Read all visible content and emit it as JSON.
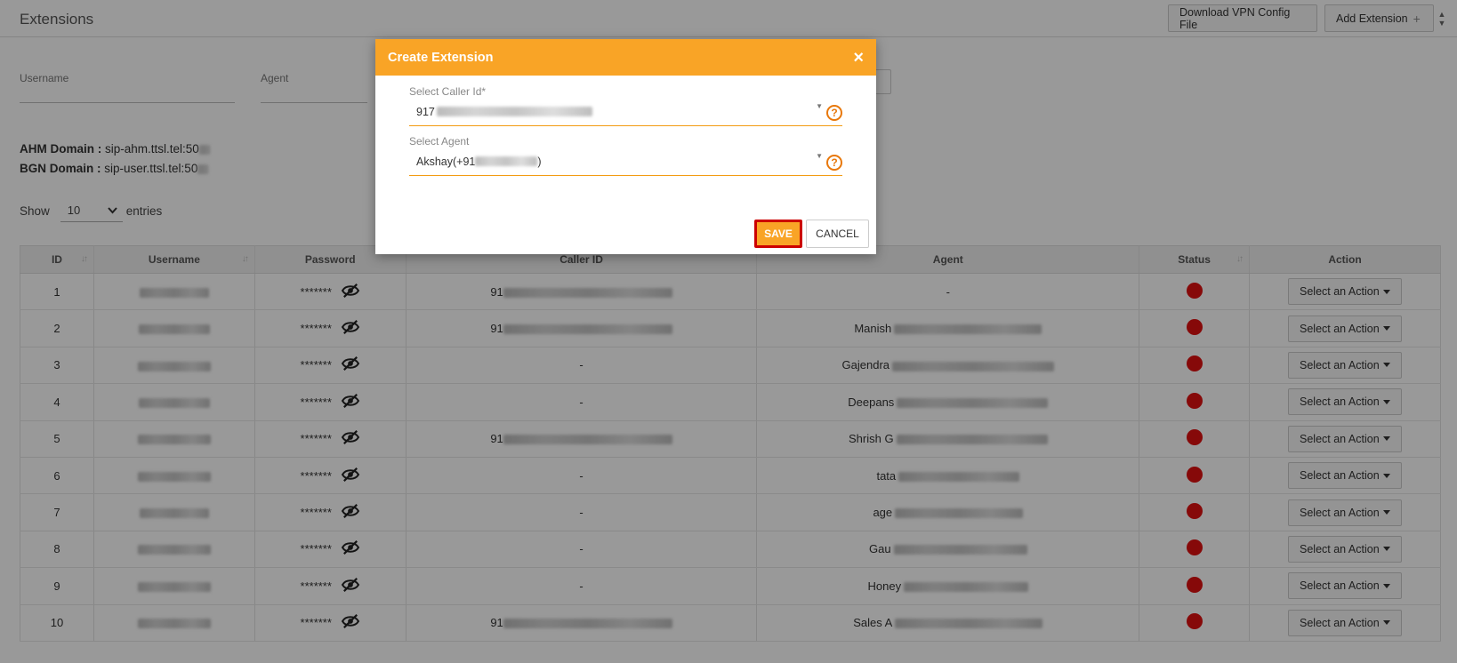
{
  "page": {
    "title": "Extensions",
    "download_vpn_label": "Download VPN Config File",
    "add_extension_label": "Add Extension",
    "add_extension_icon": "plus-icon"
  },
  "filters": {
    "username_label": "Username",
    "agent_label": "Agent"
  },
  "domains": {
    "ahm_label": "AHM Domain :",
    "ahm_value": "sip-ahm.ttsl.tel:50",
    "bgn_label": "BGN Domain :",
    "bgn_value": "sip-user.ttsl.tel:50"
  },
  "entries": {
    "show_label": "Show",
    "value": "10",
    "suffix": "entries"
  },
  "table": {
    "headers": [
      "ID",
      "Username",
      "Password",
      "Caller ID",
      "Agent",
      "Status",
      "Action"
    ],
    "rows": [
      {
        "id": "1",
        "password": "*******",
        "caller": "91",
        "agent": "-",
        "action": "Select an Action"
      },
      {
        "id": "2",
        "password": "*******",
        "caller": "91",
        "agent": "Manish",
        "action": "Select an Action"
      },
      {
        "id": "3",
        "password": "*******",
        "caller": "-",
        "agent": "Gajendra",
        "action": "Select an Action"
      },
      {
        "id": "4",
        "password": "*******",
        "caller": "-",
        "agent": "Deepans",
        "action": "Select an Action"
      },
      {
        "id": "5",
        "password": "*******",
        "caller": "91",
        "agent": "Shrish G",
        "action": "Select an Action"
      },
      {
        "id": "6",
        "password": "*******",
        "caller": "-",
        "agent": "tata",
        "action": "Select an Action"
      },
      {
        "id": "7",
        "password": "*******",
        "caller": "-",
        "agent": "age",
        "action": "Select an Action"
      },
      {
        "id": "8",
        "password": "*******",
        "caller": "-",
        "agent": "Gau",
        "action": "Select an Action"
      },
      {
        "id": "9",
        "password": "*******",
        "caller": "-",
        "agent": "Honey",
        "action": "Select an Action"
      },
      {
        "id": "10",
        "password": "*******",
        "caller": "91",
        "agent": "Sales A",
        "action": "Select an Action"
      }
    ],
    "status_color": "#e01010"
  },
  "modal": {
    "title": "Create Extension",
    "close": "×",
    "caller_label": "Select Caller Id*",
    "caller_value": "917",
    "agent_label": "Select Agent",
    "agent_value_prefix": "Akshay(+91",
    "agent_value_suffix": ")",
    "save_label": "SAVE",
    "cancel_label": "CANCEL",
    "help_glyph": "?",
    "accent": "#f9a426"
  }
}
